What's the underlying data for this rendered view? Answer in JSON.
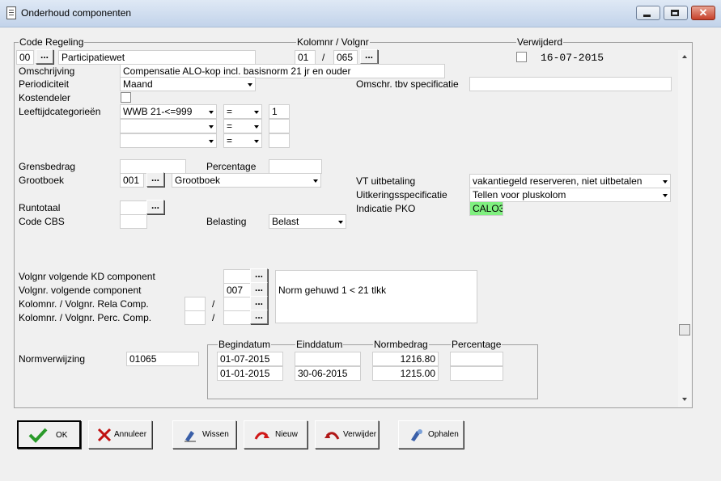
{
  "window": {
    "title": "Onderhoud componenten"
  },
  "labels": {
    "code_regeling": "Code Regeling",
    "kolomnr_volgnr": "Kolomnr / Volgnr",
    "verwijderd": "Verwijderd",
    "omschrijving": "Omschrijving",
    "periodiciteit": "Periodiciteit",
    "omschr_tbv": "Omschr. tbv specificatie",
    "kostendeler": "Kostendeler",
    "leeftijdcategorieen": "Leeftijdcategorieën",
    "grensbedrag": "Grensbedrag",
    "percentage": "Percentage",
    "grootboek": "Grootboek",
    "vt_uitbetaling": "VT uitbetaling",
    "uitkeringsspecificatie": "Uitkeringsspecificatie",
    "indicatie_pko": "Indicatie PKO",
    "runtotaal": "Runtotaal",
    "code_cbs": "Code CBS",
    "belasting": "Belasting",
    "volgnr_kd": "Volgnr volgende KD component",
    "volgnr_comp": "Volgnr. volgende component",
    "kolomnr_rela": "Kolomnr. / Volgnr. Rela Comp.",
    "kolomnr_perc": "Kolomnr. / Volgnr. Perc. Comp.",
    "normverwijzing": "Normverwijzing",
    "slash": "/"
  },
  "fields": {
    "code": "00",
    "regeling_name": "Participatiewet",
    "kolomnr": "01",
    "volgnr": "065",
    "verwijderd_date": "16-07-2015",
    "omschrijving": "Compensatie ALO-kop incl. basisnorm 21 jr en ouder",
    "periodiciteit": "Maand",
    "omschr_tbv": "",
    "leeftijd": [
      {
        "cat": "WWB 21-<=999",
        "op": "=",
        "val": "1"
      },
      {
        "cat": "",
        "op": "=",
        "val": ""
      },
      {
        "cat": "",
        "op": "=",
        "val": ""
      }
    ],
    "grensbedrag": "",
    "percentage": "",
    "grootboek_code": "001",
    "grootboek_name": "Grootboek",
    "vt_uitbetaling": "vakantiegeld reserveren, niet uitbetalen",
    "uitkeringsspecificatie": "Tellen voor pluskolom",
    "indicatie_pko": "CALO3",
    "runtotaal": "",
    "code_cbs": "",
    "belasting": "Belast",
    "volgnr_kd": "",
    "volgnr_comp": "007",
    "rela_kolom": "",
    "rela_volg": "",
    "perc_kolom": "",
    "perc_volg": "",
    "norm_desc": "Norm gehuwd 1 < 21 tlkk",
    "normverwijzing": "01065"
  },
  "dots_label": "...",
  "norm_table": {
    "headers": [
      "Begindatum",
      "Einddatum",
      "Normbedrag",
      "Percentage"
    ],
    "rows": [
      [
        "01-07-2015",
        "",
        "1216.80",
        ""
      ],
      [
        "01-01-2015",
        "30-06-2015",
        "1215.00",
        ""
      ]
    ]
  },
  "buttons": {
    "ok": "OK",
    "annuleer": "Annuleer",
    "wissen": "Wissen",
    "nieuw": "Nieuw",
    "verwijder": "Verwijder",
    "ophalen": "Ophalen"
  },
  "colors": {
    "pko_bg": "#80f080",
    "ok_check": "#2a9a2a",
    "cancel_x": "#c01010",
    "new_arrow": "#d01818"
  }
}
